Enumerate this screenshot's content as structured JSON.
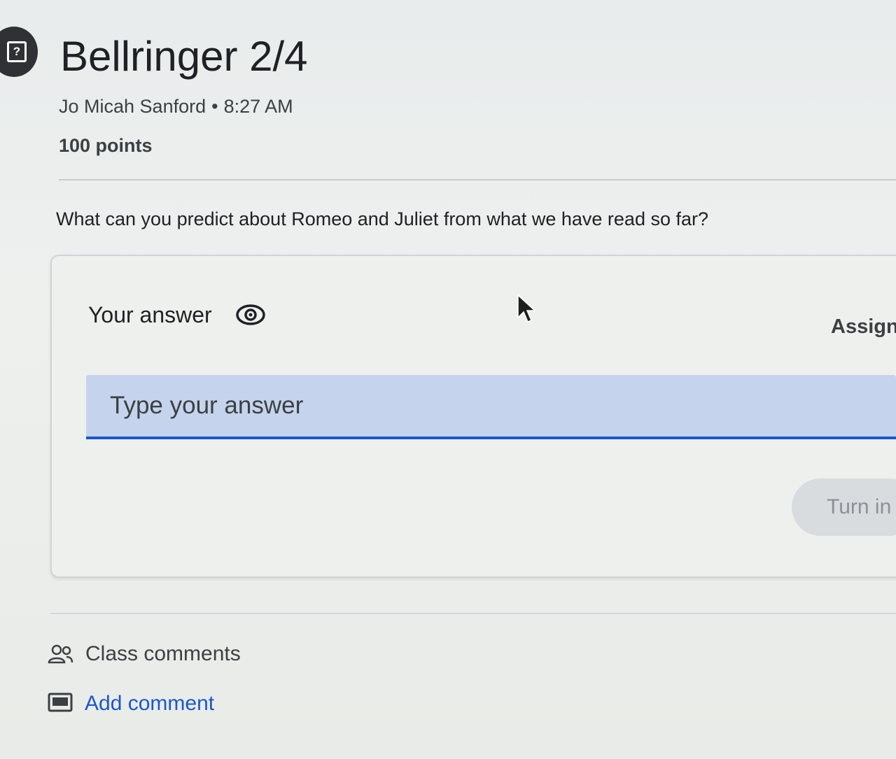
{
  "assignment": {
    "icon": "assignment-question-icon",
    "title": "Bellringer 2/4",
    "author": "Jo Micah Sanford",
    "separator": "•",
    "time": "8:27 AM",
    "points": "100 points"
  },
  "question": {
    "text": "What can you predict about Romeo and Juliet from what we have read so far?"
  },
  "answer_card": {
    "heading": "Your answer",
    "visibility_icon": "eye-icon",
    "status": "Assign",
    "input_value": "",
    "input_placeholder": "Type your answer",
    "turn_in_label": "Turn in"
  },
  "comments": {
    "class_comments_label": "Class comments",
    "class_comments_icon": "people-icon",
    "add_comment_label": "Add comment",
    "add_comment_icon": "comment-icon"
  },
  "colors": {
    "accent": "#1a57d0",
    "input_fill": "#c5d4ec",
    "background": "#eef0ee"
  }
}
